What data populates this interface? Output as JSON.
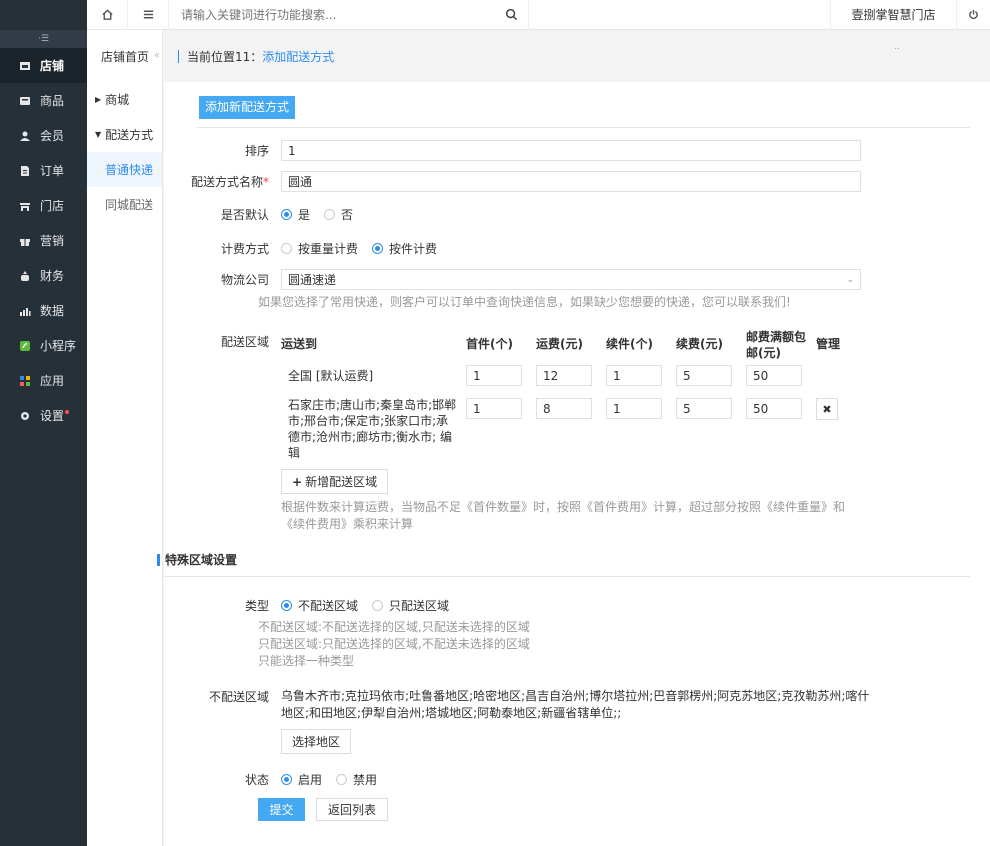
{
  "sidebar": {
    "collapse_icon": "collapse-icon",
    "items": [
      {
        "label": "店铺",
        "icon": "store-icon",
        "active": true
      },
      {
        "label": "商品",
        "icon": "goods-icon"
      },
      {
        "label": "会员",
        "icon": "user-icon"
      },
      {
        "label": "订单",
        "icon": "order-icon"
      },
      {
        "label": "门店",
        "icon": "shop-icon"
      },
      {
        "label": "营销",
        "icon": "gift-icon"
      },
      {
        "label": "财务",
        "icon": "finance-icon"
      },
      {
        "label": "数据",
        "icon": "chart-icon"
      },
      {
        "label": "小程序",
        "icon": "miniapp-icon"
      },
      {
        "label": "应用",
        "icon": "apps-icon"
      },
      {
        "label": "设置",
        "icon": "gear-icon"
      }
    ]
  },
  "topbar": {
    "search_placeholder": "请输入关键词进行功能搜索...",
    "store_name": "壹捌掌智慧门店"
  },
  "subnav": {
    "head": "店铺首页",
    "collapse_arrow": "«",
    "items": [
      {
        "label": "商城"
      },
      {
        "label": "配送方式"
      },
      {
        "label": "普通快递"
      },
      {
        "label": "同城配送"
      }
    ]
  },
  "breadcrumb": {
    "prefix": "当前位置11：",
    "current": "添加配送方式",
    "dots": ".."
  },
  "form": {
    "title": "添加新配送方式",
    "sort": {
      "label": "排序",
      "value": "1"
    },
    "name": {
      "label": "配送方式名称",
      "required": "*",
      "value": "圆通"
    },
    "is_default": {
      "label": "是否默认",
      "yes": "是",
      "no": "否"
    },
    "billing": {
      "label": "计费方式",
      "by_weight": "按重量计费",
      "by_piece": "按件计费"
    },
    "logistics": {
      "label": "物流公司",
      "selected": "圆通速递",
      "hint": "如果您选择了常用快递，则客户可以订单中查询快递信息，如果缺少您想要的快递，您可以联系我们!"
    },
    "area": {
      "label": "配送区域",
      "headers": [
        "运送到",
        "首件(个)",
        "运费(元)",
        "续件(个)",
        "续费(元)",
        "邮费满额包邮(元)",
        "管理"
      ],
      "rows": [
        {
          "region": "全国 [默认运费]",
          "first": "1",
          "fee": "12",
          "next": "1",
          "next_fee": "5",
          "free": "50"
        },
        {
          "region": "石家庄市;唐山市;秦皇岛市;邯郸市;邢台市;保定市;张家口市;承德市;沧州市;廊坊市;衡水市;",
          "edit": "编辑",
          "first": "1",
          "fee": "8",
          "next": "1",
          "next_fee": "5",
          "free": "50"
        }
      ],
      "add_button": "新增配送区域",
      "hint1": "根据件数来计算运费，当物品不足《首件数量》时，按照《首件费用》计算，超过部分按照《续件重量》和",
      "hint2": "《续件费用》乘积来计算"
    },
    "special": {
      "title": "特殊区域设置",
      "type": {
        "label": "类型",
        "opt1": "不配送区域",
        "opt2": "只配送区域",
        "hints": [
          "不配送区域:不配送选择的区域,只配送未选择的区域",
          "只配送区域:只配送选择的区域,不配送未选择的区域",
          "只能选择一种类型"
        ]
      },
      "no_delivery": {
        "label": "不配送区域",
        "line1": "乌鲁木齐市;克拉玛依市;吐鲁番地区;哈密地区;昌吉自治州;博尔塔拉州;巴音郭楞州;阿克苏地区;克孜勒苏州;喀什",
        "line2": "地区;和田地区;伊犁自治州;塔城地区;阿勒泰地区;新疆省辖单位;;",
        "select_button": "选择地区"
      },
      "status": {
        "label": "状态",
        "on": "启用",
        "off": "禁用"
      }
    },
    "submit": "提交",
    "back": "返回列表"
  }
}
